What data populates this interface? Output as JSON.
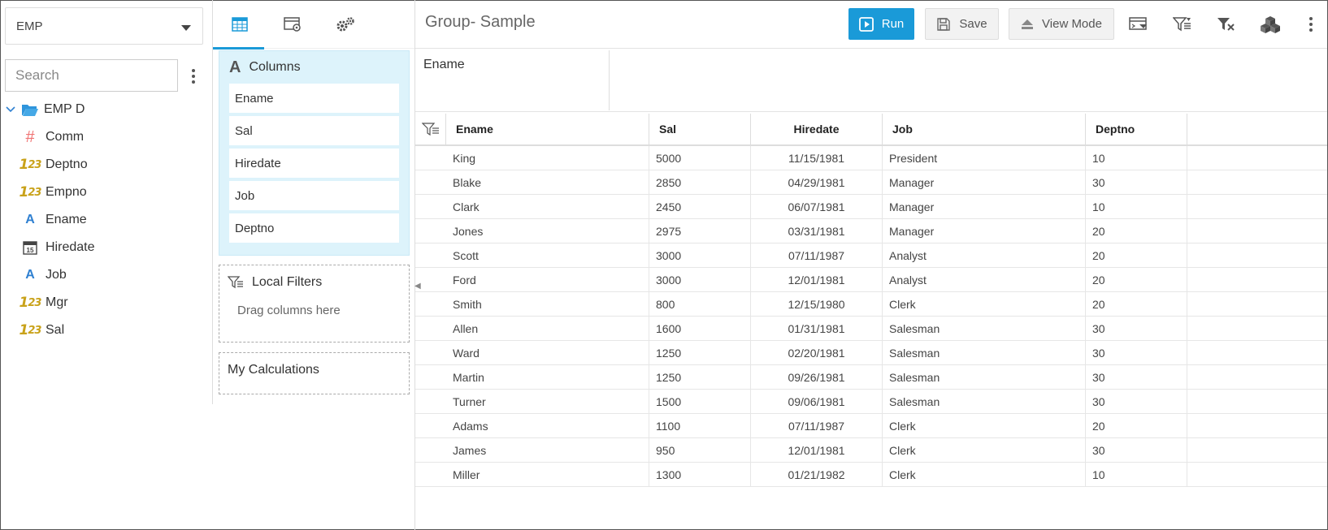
{
  "datasource": {
    "selected": "EMP"
  },
  "search": {
    "placeholder": "Search"
  },
  "tree": {
    "root": {
      "label": "EMP D"
    },
    "fields": [
      {
        "label": "Comm",
        "type": "number-hash"
      },
      {
        "label": "Deptno",
        "type": "integer"
      },
      {
        "label": "Empno",
        "type": "integer"
      },
      {
        "label": "Ename",
        "type": "text"
      },
      {
        "label": "Hiredate",
        "type": "date"
      },
      {
        "label": "Job",
        "type": "text"
      },
      {
        "label": "Mgr",
        "type": "integer"
      },
      {
        "label": "Sal",
        "type": "integer"
      }
    ]
  },
  "builder": {
    "tabs": [
      "table-view-icon",
      "settings-window-icon",
      "gears-icon"
    ],
    "columns_label": "Columns",
    "columns": [
      "Ename",
      "Sal",
      "Hiredate",
      "Job",
      "Deptno"
    ],
    "local_filters_label": "Local Filters",
    "drag_hint": "Drag columns here",
    "my_calculations_label": "My Calculations"
  },
  "header": {
    "title": "Group- Sample",
    "run_label": "Run",
    "save_label": "Save",
    "view_mode_label": "View Mode",
    "accent_color": "#1a9ad8"
  },
  "group_zone": {
    "column": "Ename"
  },
  "grid": {
    "headers": [
      "Ename",
      "Sal",
      "Hiredate",
      "Job",
      "Deptno"
    ],
    "rows": [
      [
        "King",
        "5000",
        "11/15/1981",
        "President",
        "10"
      ],
      [
        "Blake",
        "2850",
        "04/29/1981",
        "Manager",
        "30"
      ],
      [
        "Clark",
        "2450",
        "06/07/1981",
        "Manager",
        "10"
      ],
      [
        "Jones",
        "2975",
        "03/31/1981",
        "Manager",
        "20"
      ],
      [
        "Scott",
        "3000",
        "07/11/1987",
        "Analyst",
        "20"
      ],
      [
        "Ford",
        "3000",
        "12/01/1981",
        "Analyst",
        "20"
      ],
      [
        "Smith",
        "800",
        "12/15/1980",
        "Clerk",
        "20"
      ],
      [
        "Allen",
        "1600",
        "01/31/1981",
        "Salesman",
        "30"
      ],
      [
        "Ward",
        "1250",
        "02/20/1981",
        "Salesman",
        "30"
      ],
      [
        "Martin",
        "1250",
        "09/26/1981",
        "Salesman",
        "30"
      ],
      [
        "Turner",
        "1500",
        "09/06/1981",
        "Salesman",
        "30"
      ],
      [
        "Adams",
        "1100",
        "07/11/1987",
        "Clerk",
        "20"
      ],
      [
        "James",
        "950",
        "12/01/1981",
        "Clerk",
        "30"
      ],
      [
        "Miller",
        "1300",
        "01/21/1982",
        "Clerk",
        "10"
      ]
    ]
  }
}
